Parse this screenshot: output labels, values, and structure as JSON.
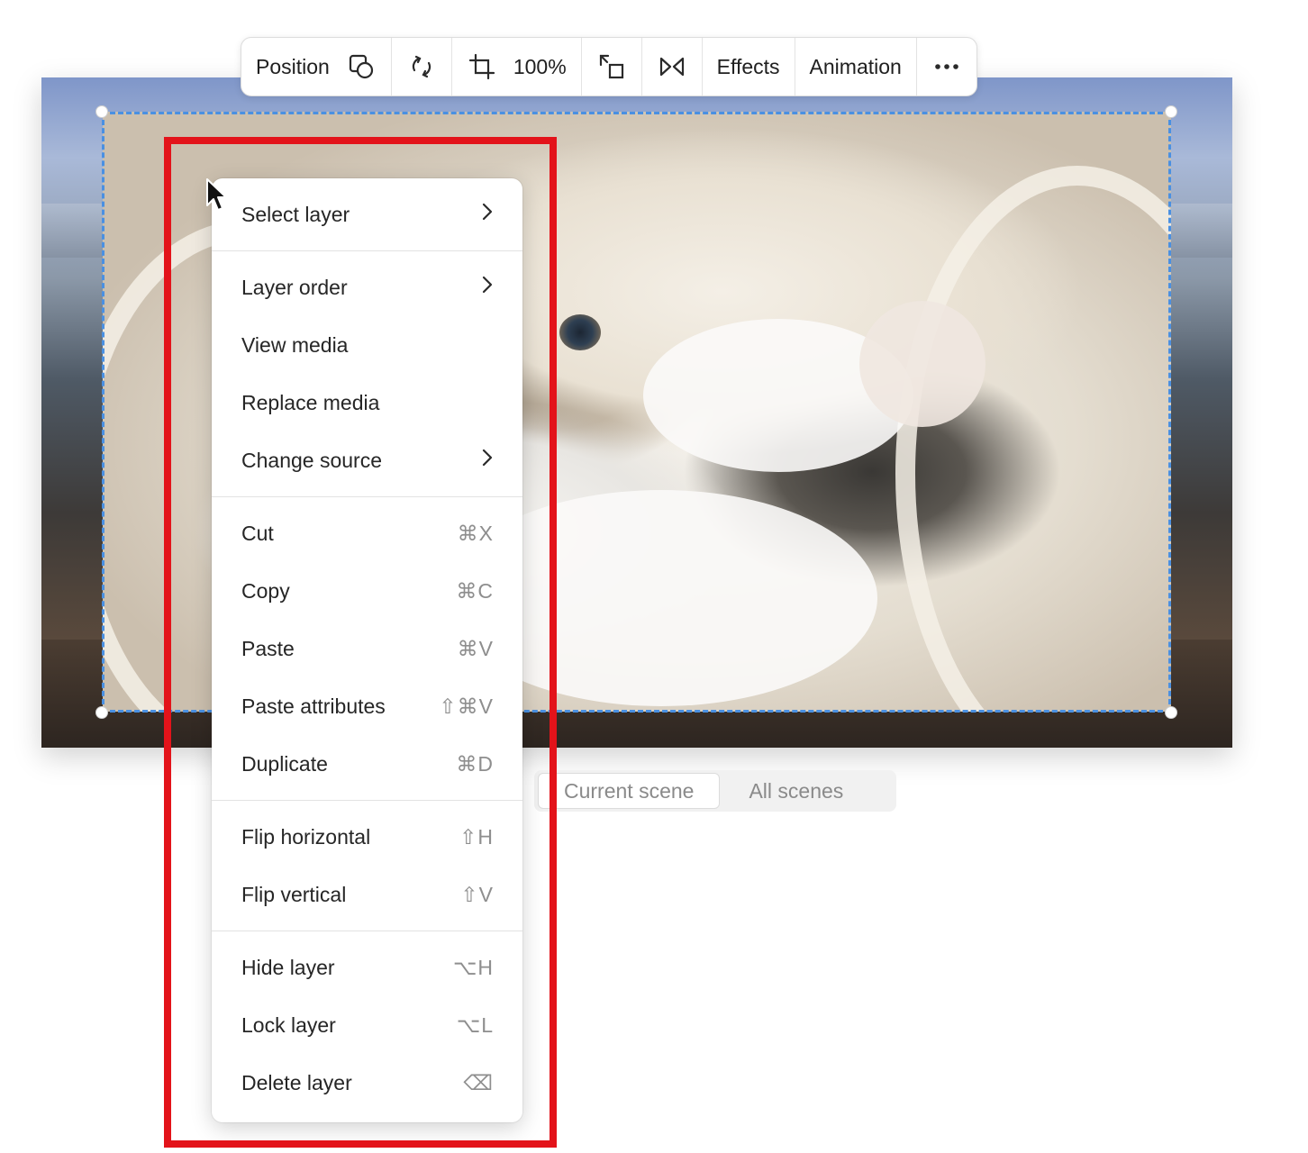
{
  "toolbar": {
    "position_label": "Position",
    "zoom_label": "100%",
    "effects_label": "Effects",
    "animation_label": "Animation",
    "icons": [
      "shapes-icon",
      "rotate-icon",
      "crop-icon",
      "resize-icon",
      "flip-icon",
      "more-icon"
    ]
  },
  "scene_toggle": {
    "current_label": "Current scene",
    "all_label": "All scenes",
    "selected": "Current scene"
  },
  "menu": {
    "sections": [
      [
        {
          "label": "Select layer",
          "shortcut": "",
          "submenu": true
        }
      ],
      [
        {
          "label": "Layer order",
          "shortcut": "",
          "submenu": true
        },
        {
          "label": "View media",
          "shortcut": "",
          "submenu": false
        },
        {
          "label": "Replace media",
          "shortcut": "",
          "submenu": false
        },
        {
          "label": "Change source",
          "shortcut": "",
          "submenu": true
        }
      ],
      [
        {
          "label": "Cut",
          "shortcut": "⌘X",
          "submenu": false
        },
        {
          "label": "Copy",
          "shortcut": "⌘C",
          "submenu": false
        },
        {
          "label": "Paste",
          "shortcut": "⌘V",
          "submenu": false
        },
        {
          "label": "Paste attributes",
          "shortcut": "⇧⌘V",
          "submenu": false
        },
        {
          "label": "Duplicate",
          "shortcut": "⌘D",
          "submenu": false
        }
      ],
      [
        {
          "label": "Flip horizontal",
          "shortcut": "⇧H",
          "submenu": false
        },
        {
          "label": "Flip vertical",
          "shortcut": "⇧V",
          "submenu": false
        }
      ],
      [
        {
          "label": "Hide layer",
          "shortcut": "⌥H",
          "submenu": false
        },
        {
          "label": "Lock layer",
          "shortcut": "⌥L",
          "submenu": false
        },
        {
          "label": "Delete layer",
          "shortcut": "⌫",
          "submenu": false
        }
      ]
    ]
  },
  "colors": {
    "selection": "#4a90e2",
    "highlight": "#e3131a"
  }
}
